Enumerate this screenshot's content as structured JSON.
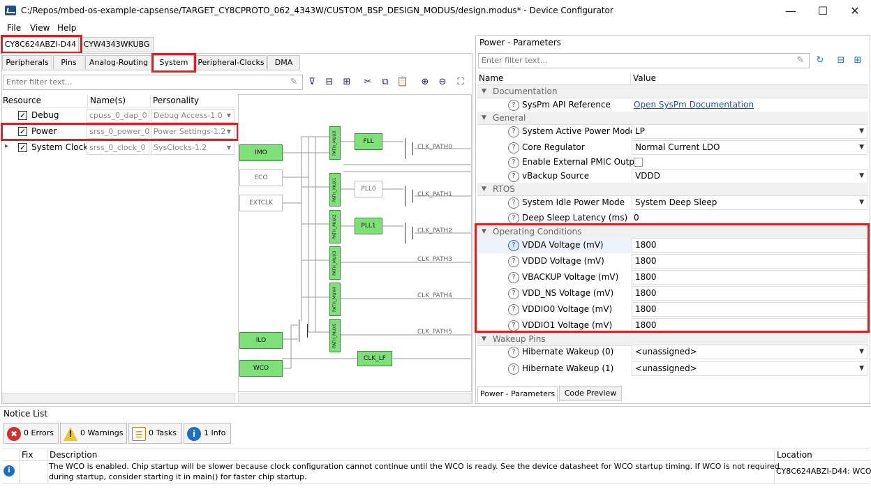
{
  "window": {
    "title": "C:/Repos/mbed-os-example-capsense/TARGET_CY8CPROTO_062_4343W/CUSTOM_BSP_DESIGN_MODUS/design.modus* - Device Configurator",
    "minimize": "—",
    "maximize": "☐",
    "close": "✕"
  },
  "menu": {
    "file": "File",
    "view": "View",
    "help": "Help"
  },
  "device_tabs": [
    "CY8C624ABZI-D44",
    "CYW4343WKUBG"
  ],
  "main_tabs": [
    "Peripherals",
    "Pins",
    "Analog-Routing",
    "System",
    "Peripheral-Clocks",
    "DMA"
  ],
  "left_filter": {
    "placeholder": "Enter filter text..."
  },
  "resource_table": {
    "headers": [
      "Resource",
      "Name(s)",
      "Personality"
    ],
    "rows": [
      {
        "resource": "Debug",
        "name": "cpuss_0_dap_0",
        "personality": "Debug Access-1.0",
        "checked": "✓"
      },
      {
        "resource": "Power",
        "name": "srss_0_power_0",
        "personality": "Power Settings-1.2",
        "checked": "✓"
      },
      {
        "resource": "System Clocks",
        "name": "srss_0_clock_0",
        "personality": "SysClocks-1.2",
        "checked": "✓",
        "expander": "▸"
      }
    ]
  },
  "clock_diagram": {
    "sources": [
      "IMO",
      "ECO",
      "EXTCLK",
      "ILO",
      "WCO"
    ],
    "muxes": [
      "PATH_MUX0",
      "PATH_MUX1",
      "PATH_MUX2",
      "PATH_MUX3",
      "PATH_MUX4",
      "PATH_MUX5"
    ],
    "blocks": {
      "fll": "FLL",
      "pll0": "PLL0",
      "pll1": "PLL1",
      "clk_lf": "CLK_LF"
    },
    "paths": [
      "CLK_PATH0",
      "CLK_PATH1",
      "CLK_PATH2",
      "CLK_PATH3",
      "CLK_PATH4",
      "CLK_PATH5"
    ]
  },
  "params_panel": {
    "title": "Power - Parameters",
    "filter_placeholder": "Enter filter text...",
    "headers": [
      "Name",
      "Value"
    ],
    "categories": {
      "documentation": "Documentation",
      "general": "General",
      "rtos": "RTOS",
      "operating": "Operating Conditions",
      "wakeup": "Wakeup Pins"
    },
    "doc_row": {
      "name": "SysPm API Reference",
      "value": "Open SysPm Documentation"
    },
    "general_rows": [
      {
        "name": "System Active Power Mode",
        "value": "LP"
      },
      {
        "name": "Core Regulator",
        "value": "Normal Current LDO"
      },
      {
        "name": "Enable External PMIC Output",
        "value": ""
      },
      {
        "name": "vBackup Source",
        "value": "VDDD"
      }
    ],
    "rtos_rows": [
      {
        "name": "System Idle Power Mode",
        "value": "System Deep Sleep"
      },
      {
        "name": "Deep Sleep Latency (ms)",
        "value": "0"
      }
    ],
    "operating_rows": [
      {
        "name": "VDDA Voltage (mV)",
        "value": "1800"
      },
      {
        "name": "VDDD Voltage (mV)",
        "value": "1800"
      },
      {
        "name": "VBACKUP Voltage (mV)",
        "value": "1800"
      },
      {
        "name": "VDD_NS Voltage (mV)",
        "value": "1800"
      },
      {
        "name": "VDDIO0 Voltage (mV)",
        "value": "1800"
      },
      {
        "name": "VDDIO1 Voltage (mV)",
        "value": "1800"
      }
    ],
    "wakeup_rows": [
      {
        "name": "Hibernate Wakeup (0)",
        "value": "<unassigned>"
      },
      {
        "name": "Hibernate Wakeup (1)",
        "value": "<unassigned>"
      }
    ],
    "bottom_tabs": [
      "Power - Parameters",
      "Code Preview"
    ]
  },
  "notice_list": {
    "title": "Notice List",
    "buttons": [
      {
        "label": "0 Errors",
        "icon": "✖",
        "color": "#d32f2f"
      },
      {
        "label": "0 Warnings",
        "icon": "!",
        "color": "#f5c518"
      },
      {
        "label": "0 Tasks",
        "icon": "☰",
        "color": "#b8860b"
      },
      {
        "label": "1 Info",
        "icon": "i",
        "color": "#1e6fc4"
      }
    ],
    "headers": [
      "Fix",
      "Description",
      "Location"
    ],
    "rows": [
      {
        "description_line1": "The WCO is enabled. Chip startup will be slower because clock configuration cannot continue until the WCO is ready. See the device datasheet for WCO startup timing. If WCO is not required",
        "description_line2": "during startup, consider starting it in main() for faster chip startup.",
        "location": "CY8C624ABZI-D44: WCO"
      }
    ]
  }
}
